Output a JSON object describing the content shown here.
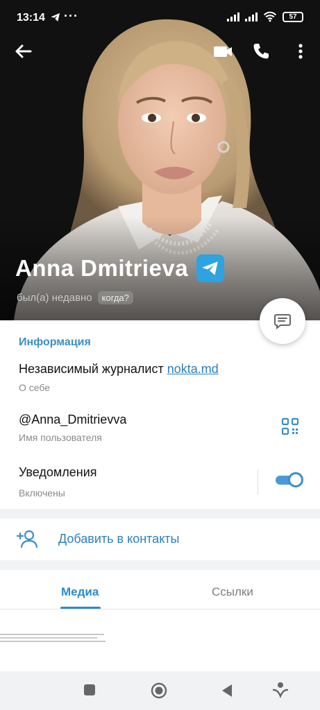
{
  "status_bar": {
    "time": "13:14",
    "battery": "57",
    "more": "···"
  },
  "topbar": {
    "back_icon": "arrow-left-icon",
    "video_icon": "video-camera-icon",
    "call_icon": "phone-icon",
    "menu_icon": "more-vertical-icon"
  },
  "profile": {
    "name": "Anna Dmitrieva",
    "last_seen": "был(а) недавно",
    "when_label": "когда?"
  },
  "info": {
    "section_title": "Информация",
    "bio_text": "Независимый журналист ",
    "bio_link": "nokta.md",
    "bio_caption": "О себе",
    "username": "@Anna_Dmitrievva",
    "username_caption": "Имя пользователя",
    "notifications": "Уведомления",
    "notifications_state": "Включены"
  },
  "actions": {
    "add_contact": "Добавить в контакты"
  },
  "tabs": {
    "media": "Медиа",
    "links": "Ссылки"
  },
  "colors": {
    "accent": "#2a8bcc",
    "verified": "#2da3e0",
    "header_bg": "#121212"
  }
}
